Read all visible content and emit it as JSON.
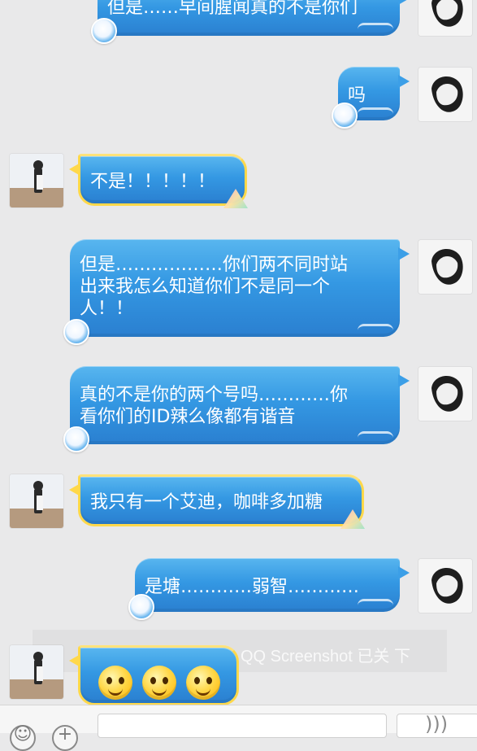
{
  "chat": {
    "messages": [
      {
        "from": "self",
        "text": "但是……早间腥闻真的不是你们"
      },
      {
        "from": "self",
        "text": "吗"
      },
      {
        "from": "other",
        "text": "不是！！！！！"
      },
      {
        "from": "self",
        "text": "但是………………你们两不同时站\n出来我怎么知道你们不是同一个\n人！！"
      },
      {
        "from": "self",
        "text": "真的不是你的两个号吗…………你\n看你们的ID辣么像都有谐音"
      },
      {
        "from": "other",
        "text": "我只有一个艾迪，咖啡多加糖"
      },
      {
        "from": "self",
        "text": "是塘…………弱智…………"
      },
      {
        "from": "other",
        "emoji": [
          "smile-face",
          "smile-face",
          "smile-face"
        ]
      }
    ]
  },
  "watermark": {
    "text": "QQ Screenshot 已关 下"
  },
  "bottom": {
    "voice_icon": "voice-icon",
    "left_icons": [
      "emoji-icon",
      "plus-icon"
    ]
  }
}
